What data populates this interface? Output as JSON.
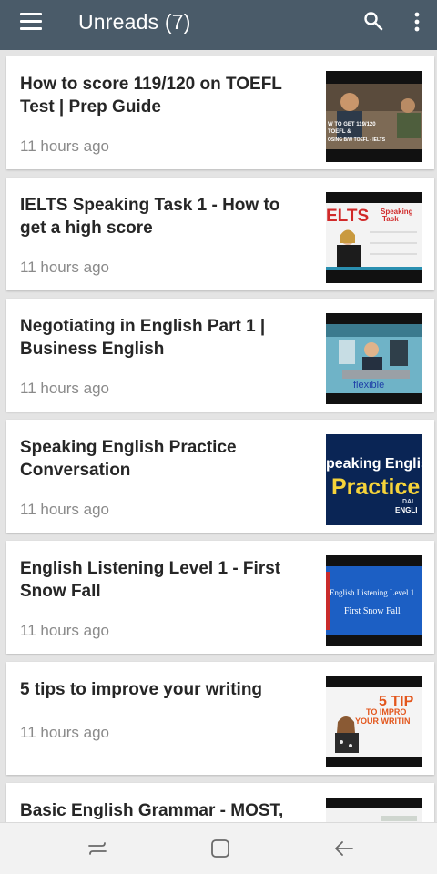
{
  "app_bar": {
    "title": "Unreads (7)",
    "icons": [
      "menu-icon",
      "search-icon",
      "more-vert-icon"
    ],
    "color": "#4a5b69"
  },
  "items": [
    {
      "title": "How to score 119/120 on TOEFL Test | Prep Guide",
      "time": "11 hours ago",
      "thumb_text": [
        "W TO GET 119/120",
        "TOEFL &",
        "OSING B/W TOEFL - IELTS"
      ]
    },
    {
      "title": "IELTS Speaking Task 1 - How to get a high score",
      "time": "11 hours ago",
      "thumb_text": [
        "ELTS",
        "Speaking",
        "Task"
      ]
    },
    {
      "title": "Negotiating in English Part 1 | Business English",
      "time": "11 hours ago",
      "thumb_text": [
        "flexible"
      ]
    },
    {
      "title": "Speaking English Practice Conversation",
      "time": "11 hours ago",
      "thumb_text": [
        "peaking Englis",
        "Practice",
        "DAI",
        "ENGLI"
      ]
    },
    {
      "title": "English Listening Level 1 - First Snow Fall",
      "time": "11 hours ago",
      "thumb_text": [
        "English Listening Level 1",
        "First Snow Fall"
      ]
    },
    {
      "title": "5 tips to improve your writing",
      "time": "11 hours ago",
      "thumb_text": [
        "5 TIP",
        "TO IMPRO",
        "YOUR WRITIN"
      ]
    },
    {
      "title": "Basic English Grammar - MOST, ALMOST or ALMOST ALL",
      "time": "",
      "thumb_text": []
    }
  ],
  "nav_bar": {
    "icons": [
      "recent-apps-icon",
      "home-icon",
      "back-icon"
    ]
  }
}
